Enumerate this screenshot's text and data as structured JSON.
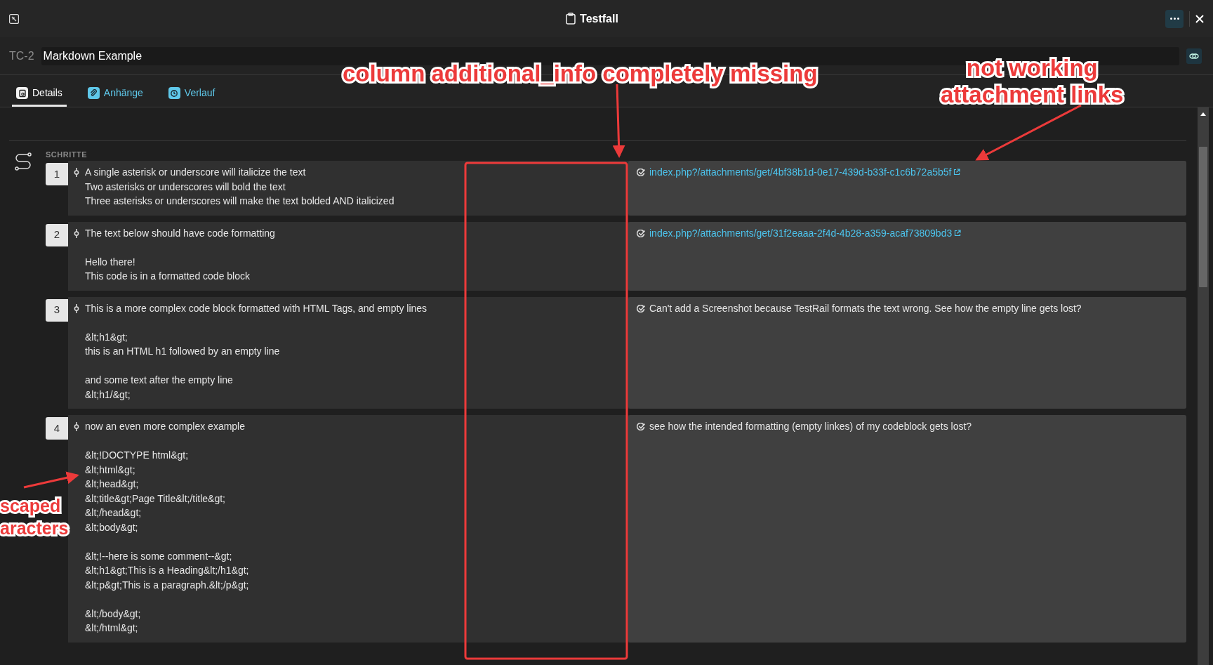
{
  "window": {
    "title": "Testfall"
  },
  "test_case": {
    "id": "TC-2",
    "title": "Markdown Example"
  },
  "tabs": [
    {
      "label": "Details",
      "selected": true
    },
    {
      "label": "Anhänge",
      "selected": false
    },
    {
      "label": "Verlauf",
      "selected": false
    }
  ],
  "steps_section": {
    "heading": "SCHRITTE"
  },
  "steps": [
    {
      "number": "1",
      "content": [
        [
          "A single asterisk or underscore will italicize the text",
          "Two asterisks or underscores will bold the text",
          "Three asterisks or underscores will make the text bolded AND italicized"
        ]
      ],
      "expected": {
        "kind": "link",
        "text": "index.php?/attachments/get/4bf38b1d-0e17-439d-b33f-c1c6b72a5b5f"
      }
    },
    {
      "number": "2",
      "content": [
        [
          "The text below should have code formatting"
        ],
        [
          "Hello there!",
          "This code is in a formatted code block"
        ]
      ],
      "expected": {
        "kind": "link",
        "text": "index.php?/attachments/get/31f2eaaa-2f4d-4b28-a359-acaf73809bd3"
      }
    },
    {
      "number": "3",
      "content": [
        [
          "This is a more complex code block formatted with HTML Tags, and empty lines"
        ],
        [
          "&lt;h1&gt;",
          "this is an HTML h1 followed by an empty line"
        ],
        [
          "and some text after the empty line",
          "&lt;h1/&gt;"
        ]
      ],
      "expected": {
        "kind": "text",
        "text": "Can't add a Screenshot because TestRail formats the text wrong. See how the empty line gets lost?"
      }
    },
    {
      "number": "4",
      "content": [
        [
          "now an even more complex example"
        ],
        [
          "&lt;!DOCTYPE html&gt;",
          "&lt;html&gt;",
          "&lt;head&gt;",
          "&lt;title&gt;Page Title&lt;/title&gt;",
          "&lt;/head&gt;",
          "&lt;body&gt;"
        ],
        [
          "&lt;!--here is some comment--&gt;",
          "&lt;h1&gt;This is a Heading&lt;/h1&gt;",
          "&lt;p&gt;This is a paragraph.&lt;/p&gt;"
        ],
        [
          "&lt;/body&gt;",
          "&lt;/html&gt;"
        ]
      ],
      "expected": {
        "kind": "text",
        "text": "see how the intended formatting (empty linkes) of my codeblock gets lost?"
      }
    }
  ],
  "annotations": [
    {
      "lines": [
        "column additional_info completely missing"
      ]
    },
    {
      "lines": [
        "not working",
        "attachment links"
      ]
    },
    {
      "lines": [
        "scaped",
        "aracters"
      ]
    }
  ]
}
